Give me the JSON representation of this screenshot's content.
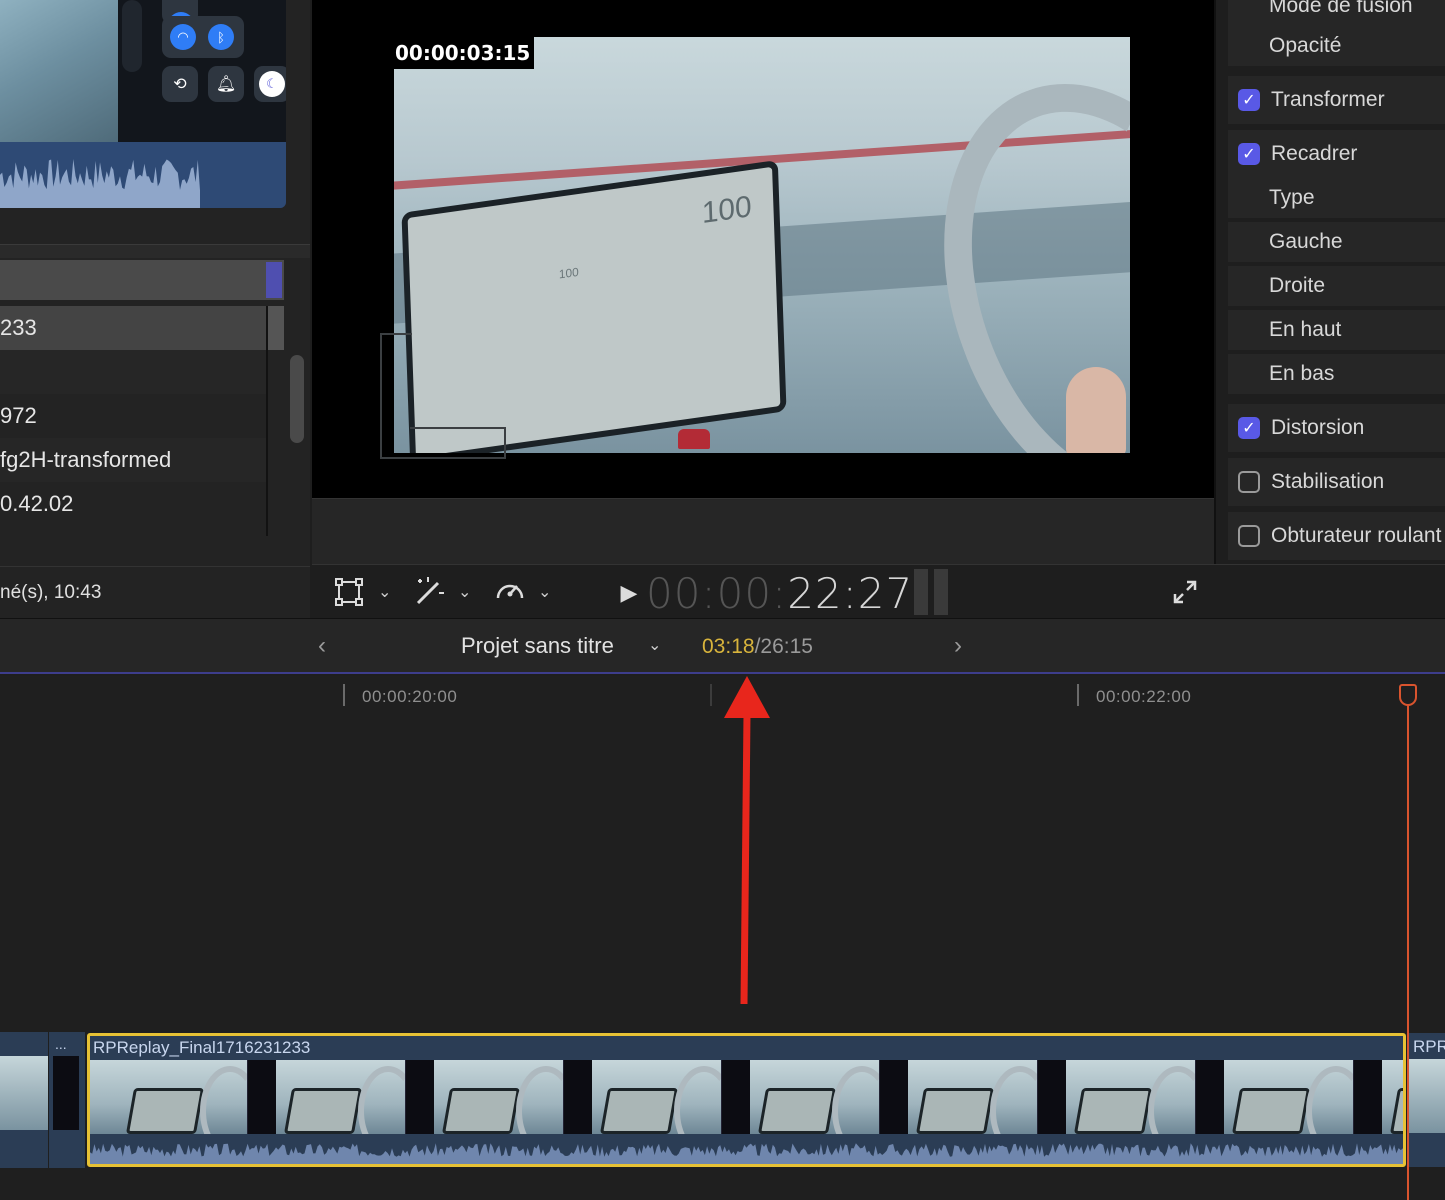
{
  "browser": {
    "list_rows": [
      {
        "text": "233",
        "selected": true
      },
      {
        "text": "",
        "selected": false
      },
      {
        "text": "972",
        "selected": false
      },
      {
        "text": "fg2H-transformed",
        "selected": false
      },
      {
        "text": "0.42.02",
        "selected": false
      }
    ],
    "status": "né(s), 10:43"
  },
  "viewer": {
    "burned_timecode": "00:00:03:15",
    "tablet_readout": "100",
    "tablet_small": "100"
  },
  "viewer_toolbar": {
    "timecode_dim": "00:00:",
    "timecode_bright": "22:27",
    "transform_icon": "transform-icon",
    "effects_icon": "magic-wand-icon",
    "speed_icon": "speedometer-icon",
    "play_icon": "play-icon",
    "fullscreen_icon": "fullscreen-icon"
  },
  "inspector": {
    "rows": [
      {
        "label": "Mode de fusion",
        "kind": "sub"
      },
      {
        "label": "Opacité",
        "kind": "sub"
      },
      {
        "label": "Transformer",
        "kind": "header",
        "checked": true
      },
      {
        "label": "Recadrer",
        "kind": "header",
        "checked": true
      },
      {
        "label": "Type",
        "kind": "sub"
      },
      {
        "label": "Gauche",
        "kind": "sub"
      },
      {
        "label": "Droite",
        "kind": "sub"
      },
      {
        "label": "En haut",
        "kind": "sub"
      },
      {
        "label": "En bas",
        "kind": "sub"
      },
      {
        "label": "Distorsion",
        "kind": "header",
        "checked": true
      },
      {
        "label": "Stabilisation",
        "kind": "header",
        "checked": false
      },
      {
        "label": "Obturateur roulant",
        "kind": "header",
        "checked": false
      }
    ],
    "checkbox_color": "#5959e6"
  },
  "timeline_header": {
    "project_title": "Projet sans titre",
    "current_time": "03:18",
    "total_time": "/26:15"
  },
  "timeline": {
    "ruler": [
      "00:00:20:00",
      "00:00:22:00"
    ],
    "gap_label": "...",
    "main_clip_title": "RPReplay_Final1716231233",
    "next_clip_title": "RPR",
    "playhead_color": "#d9542e",
    "selection_color": "#e7c235",
    "annotation_arrow_color": "#e8261c"
  }
}
